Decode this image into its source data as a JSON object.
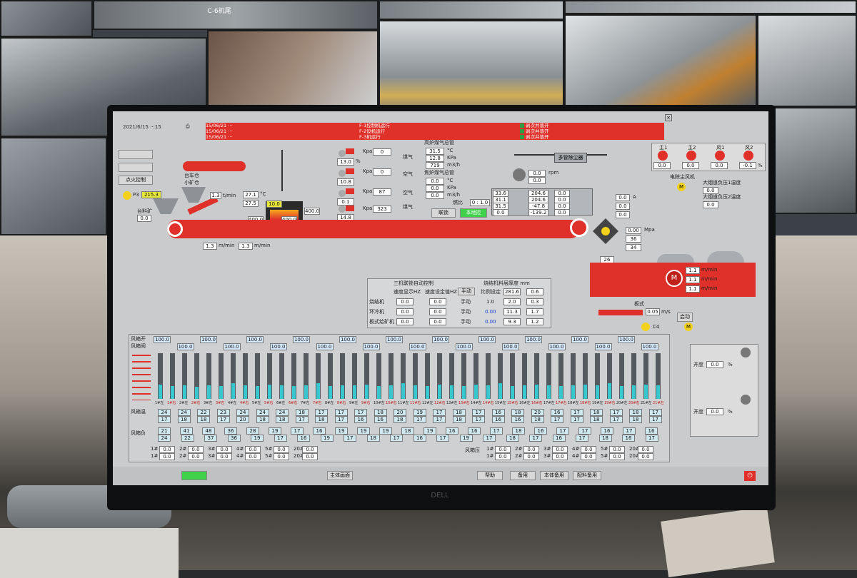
{
  "scene": {
    "camera_labels": [
      "C-6机尾"
    ],
    "monitor_brand": "DELL"
  },
  "hmi": {
    "datetime": "2021/6/15 ··:15",
    "alarms": [
      {
        "left": "15/06/21 ···",
        "middle": "F-1控制机运行",
        "right": "剥次并落开"
      },
      {
        "left": "15/06/21 ···",
        "middle": "F-2设机运行",
        "right": "剥次并落开"
      },
      {
        "left": "15/06/21 ···",
        "middle": "F-3机运行",
        "right": "剥次并落开"
      }
    ],
    "left_buttons": [
      "",
      "",
      "点火控制"
    ],
    "p3_label": "P3",
    "p3_value": "215.3",
    "hopper_labels": [
      "台料矿",
      "台车仓",
      "小矿仓"
    ],
    "hopper_values": [
      "1.3",
      "27.1",
      "27.5",
      "0.0"
    ],
    "hopper_unit": "t/min",
    "temp_unit": "°C",
    "ignition_values": [
      "10.0",
      "400.0",
      "400.0",
      "400.0"
    ],
    "main_pressure_label": "高炉煤气总管",
    "main_pressure_values": [
      "31.5",
      "12.8",
      "719"
    ],
    "main_pressure_units": [
      "°C",
      "KPa",
      "m3/h"
    ],
    "coke_label": "焦炉煤气总管",
    "coke_values": [
      "0.0",
      "0.0",
      "0.0"
    ],
    "coke_units": [
      "°C",
      "KPa",
      "m3/h"
    ],
    "gas_lines": [
      {
        "label": "煤气",
        "pct": "13.0",
        "unit": "Kpa",
        "value": "0"
      },
      {
        "label": "空气",
        "pct": "10.8",
        "unit": "Kpa",
        "value": "0"
      },
      {
        "label": "空气",
        "pct": "0.1",
        "unit": "Kpa",
        "value": "87"
      },
      {
        "label": "煤气",
        "pct": "14.8",
        "unit": "Kpa",
        "value": "323"
      }
    ],
    "pct_sign": "%",
    "ratio_label": "燃比",
    "ratio_value": "0 : 1.0",
    "buttons_mid": [
      "联锁",
      "本地控"
    ],
    "fan_header": "多管除尘器",
    "fan_values": [
      "0.0",
      "0.0"
    ],
    "fan_unit": "rpm",
    "chamber_values_col1": [
      "33.6",
      "31.1",
      "31.5",
      "0.0"
    ],
    "chamber_values_col2": [
      "204.6",
      "204.6",
      "-47.8",
      "-139.2"
    ],
    "chamber_values_col3": [
      "0.0",
      "0.0",
      "0.0",
      "0.0"
    ],
    "amp_values": [
      "0.0",
      "0.0",
      "0.0"
    ],
    "amp_unit": "A",
    "press_values": [
      "0.00",
      "36",
      "34"
    ],
    "press_unit": "Mpa",
    "strand_speed_values": [
      "1.3",
      "1.3"
    ],
    "strand_speed_unit": "m/min",
    "cooler_label": "环冷",
    "cooler_speeds": [
      "1.1",
      "1.1",
      "1.1"
    ],
    "cooler_unit": "m/min",
    "cooler_num": "26",
    "belt_label": "板式",
    "belt_value": "0.05",
    "belt_unit": "m/s",
    "belt_btn": "启动",
    "c4_label": "C4",
    "top_fans": {
      "labels": [
        "主1",
        "主2",
        "风1",
        "风2"
      ],
      "values": [
        "0.0",
        "0.0",
        "0.0",
        "-0.1"
      ],
      "unit": "%"
    },
    "right_labels": [
      "电除尘风机",
      "大烟道负压1温度",
      "大烟道负压2温度"
    ],
    "right_values": [
      "0.0",
      "0.0"
    ],
    "table_title": "三机联锁自动控制",
    "table_title2": "烧结机料层厚度 mm",
    "table_headers": [
      "速度显示HZ",
      "速度设定值HZ",
      "手动",
      "比例设定",
      "281.6",
      "0.6"
    ],
    "table_rows": [
      {
        "name": "烧结机",
        "vals": [
          "0.0",
          "0.0",
          "手动",
          "",
          "1.0",
          "2.0",
          "0.3"
        ]
      },
      {
        "name": "环冷机",
        "vals": [
          "0.0",
          "0.0",
          "手动",
          "0.00",
          "11.3",
          "1.7"
        ]
      },
      {
        "name": "板式给矿机",
        "vals": [
          "0.0",
          "0.0",
          "手动",
          "0.00",
          "9.3",
          "1.2"
        ]
      }
    ],
    "fan_row_label1": "风箱开",
    "fan_row_label2": "风箱阀",
    "valve_values": [
      "100.0",
      "100.0",
      "100.0",
      "100.0",
      "100.0",
      "100.0",
      "100.0",
      "100.0",
      "100.0",
      "100.0",
      "100.0",
      "100.0",
      "100.0",
      "100.0",
      "100.0",
      "100.0",
      "100.0",
      "100.0",
      "100.0",
      "100.0",
      "100.0",
      "100.0"
    ],
    "bar_levels": [
      0.32,
      0.28,
      0.3,
      0.26,
      0.3,
      0.28,
      0.34,
      0.3,
      0.28,
      0.32,
      0.3,
      0.28,
      0.3,
      0.34,
      0.28,
      0.3,
      0.3,
      0.32,
      0.28,
      0.3,
      0.34,
      0.3,
      0.28,
      0.32,
      0.3,
      0.28,
      0.32,
      0.3,
      0.34,
      0.28,
      0.3,
      0.32,
      0.3,
      0.28,
      0.3,
      0.32,
      0.3,
      0.34,
      0.28,
      0.3,
      0.32,
      0.3
    ],
    "box_labels": [
      "1#左",
      "1#右",
      "2#左",
      "2#右",
      "3#左",
      "3#右",
      "4#左",
      "4#右",
      "5#左",
      "5#右",
      "6#左",
      "6#右",
      "7#左",
      "7#右",
      "8#左",
      "8#右",
      "9#左",
      "9#右",
      "10#左",
      "10#右",
      "11#左",
      "11#右",
      "12#左",
      "12#右",
      "13#左",
      "13#右",
      "14#左",
      "14#右",
      "15#左",
      "15#右",
      "16#左",
      "16#右",
      "17#左",
      "17#右",
      "18#左",
      "18#右",
      "19#左",
      "19#右",
      "20#左",
      "20#右",
      "21#左",
      "21#右"
    ],
    "temp_row_label": "风箱温",
    "temp_row1": [
      "24",
      "24",
      "22",
      "23",
      "24",
      "24",
      "24",
      "18",
      "17",
      "17",
      "17",
      "18",
      "20",
      "19",
      "17",
      "18",
      "17",
      "16",
      "18",
      "20",
      "16",
      "17",
      "18",
      "17",
      "18",
      "17"
    ],
    "temp_row2": [
      "17",
      "18",
      "18",
      "17",
      "20",
      "18",
      "18",
      "17",
      "18",
      "17",
      "16",
      "16",
      "18",
      "17",
      "17",
      "18",
      "17",
      "16",
      "16",
      "18",
      "17",
      "17",
      "18",
      "17",
      "18",
      "17"
    ],
    "neg_row_label": "风箱负",
    "neg_row1": [
      "21",
      "41",
      "48",
      "36",
      "28",
      "19",
      "17",
      "16",
      "19",
      "19",
      "19",
      "18",
      "19",
      "16",
      "16",
      "17",
      "18",
      "16",
      "17",
      "17",
      "16",
      "17",
      "16"
    ],
    "neg_row2": [
      "24",
      "22",
      "37",
      "36",
      "19",
      "17",
      "16",
      "19",
      "17",
      "18",
      "17",
      "16",
      "17",
      "19",
      "17",
      "18",
      "17",
      "16",
      "17",
      "18",
      "16",
      "17"
    ],
    "bottom_left_rows": [
      [
        "1#",
        "0.0",
        "2#",
        "0.0",
        "3#",
        "0.0",
        "4#",
        "0.0",
        "5#",
        "0.0",
        "20#",
        "0.0"
      ],
      [
        "1#",
        "0.0",
        "2#",
        "0.0",
        "3#",
        "0.0",
        "4#",
        "0.0",
        "5#",
        "0.0",
        "20#",
        "0.0"
      ]
    ],
    "bottom_right_label": "风箱压",
    "bottom_right_rows": [
      [
        "1#",
        "0.0",
        "2#",
        "0.0",
        "3#",
        "0.0",
        "4#",
        "0.0",
        "5#",
        "0.0",
        "20#",
        "0.0"
      ],
      [
        "1#",
        "0.0",
        "2#",
        "0.0",
        "3#",
        "0.0",
        "4#",
        "0.0",
        "5#",
        "0.0",
        "20#",
        "0.0"
      ]
    ],
    "right_panel": [
      {
        "label": "开度",
        "value": "0.0",
        "unit": "%"
      },
      {
        "label": "开度",
        "value": "0.0",
        "unit": "%"
      }
    ],
    "footer_buttons": [
      "主体画面",
      "帮助",
      "台车",
      "备用",
      "本体备用",
      "配料备用"
    ]
  }
}
